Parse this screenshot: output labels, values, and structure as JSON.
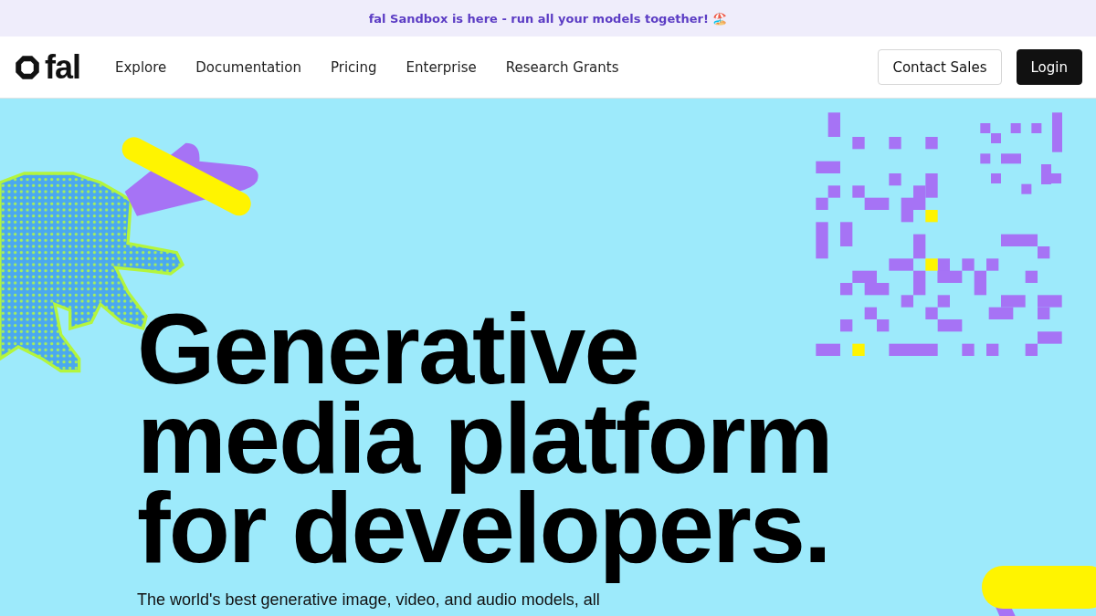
{
  "announcement": {
    "text": "fal Sandbox is here - run all your models together!",
    "emoji": "🏖️"
  },
  "nav": {
    "logo": "fal",
    "links": [
      "Explore",
      "Documentation",
      "Pricing",
      "Enterprise",
      "Research Grants"
    ],
    "buttons": [
      {
        "label": "Contact Sales",
        "kind": "outline"
      },
      {
        "label": "Login",
        "kind": "solid"
      }
    ]
  },
  "hero": {
    "headline": [
      "Generative",
      "media platform",
      "for developers."
    ],
    "subtitle": "The world's best generative image, video, and audio models, all"
  }
}
